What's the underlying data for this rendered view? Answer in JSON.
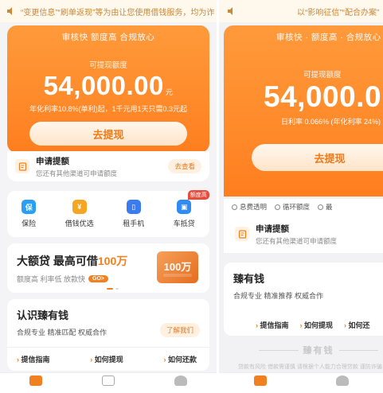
{
  "left": {
    "notice": "“变更信息”“刷单返现”等为由让您使用借钱服务，均为诈",
    "hero": {
      "tag": "审核快  额度高  合规放心",
      "label": "可提现额度",
      "amount": "54,000.00",
      "unit": "元",
      "rate": "年化利率10.8%(单利)起，1千元用1天只需0.3元起",
      "cta": "去提现"
    },
    "apply": {
      "title": "申请提额",
      "subtitle": "您还有其他渠道可申请额度",
      "button": "去查看"
    },
    "quick": [
      {
        "label": "保险",
        "icon": "shield-icon",
        "color": "#2a9df4",
        "glyph": "保"
      },
      {
        "label": "借钱优选",
        "icon": "moneybag-icon",
        "color": "#f5a623",
        "glyph": "¥"
      },
      {
        "label": "租手机",
        "icon": "phone-icon",
        "color": "#3a7bf0",
        "glyph": "▯"
      },
      {
        "label": "车抵贷",
        "icon": "car-icon",
        "color": "#2f8cf2",
        "glyph": "▣",
        "badge": "额度高"
      }
    ],
    "banner": {
      "title_prefix": "大额贷  最高可借",
      "title_hl": "100万",
      "subtitle": "额度高  利率低  放款快",
      "go": "GO>",
      "box_amount": "100万"
    },
    "about": {
      "title": "认识臻有钱",
      "subtitle": "合规专业  精准匹配  权威合作",
      "button": "了解我们",
      "links": [
        "提信指南",
        "如何提现",
        "如何还款"
      ]
    }
  },
  "right": {
    "notice": "以“影响征信”“配合办案”",
    "hero": {
      "tag": "审核快 · 额度高 · 合规放心",
      "label": "可提现额度",
      "amount": "54,000.0",
      "rate": "日利率 0.066% (年化利率 24%)",
      "cta": "去提现"
    },
    "features": [
      "息费透明",
      "循环额度",
      "最"
    ],
    "apply": {
      "title": "申请提额",
      "subtitle": "您还有其他渠道可申请额度"
    },
    "about": {
      "title": "臻有钱",
      "subtitle": "合规专业  精准推荐  权威合作",
      "links": [
        "提信指南",
        "如何提现",
        "如何还"
      ]
    },
    "brand": "臻有钱",
    "disclaimer": "贷款有风险 借款需谨慎 请根据个人能力合理贷款 谨防诈骗"
  },
  "colors": {
    "accent": "#ff8a2a",
    "link": "#f08020"
  }
}
